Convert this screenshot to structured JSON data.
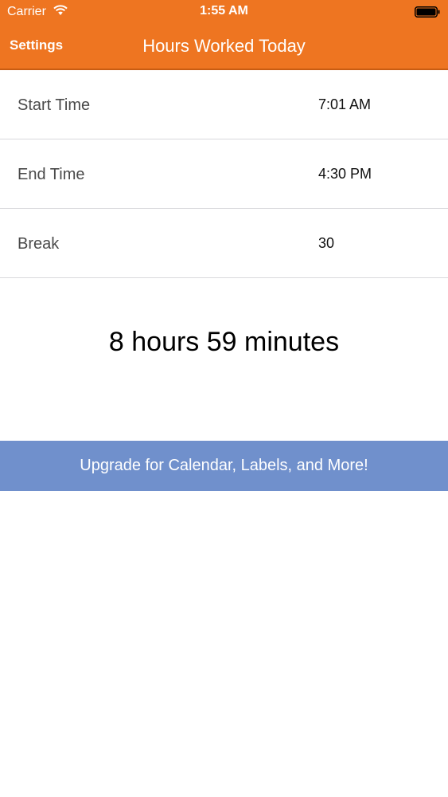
{
  "status_bar": {
    "carrier": "Carrier",
    "time": "1:55 AM"
  },
  "nav": {
    "back_label": "Settings",
    "title": "Hours Worked Today"
  },
  "rows": [
    {
      "label": "Start Time",
      "value": "7:01 AM"
    },
    {
      "label": "End Time",
      "value": "4:30 PM"
    },
    {
      "label": "Break",
      "value": "30"
    }
  ],
  "total": "8 hours 59 minutes",
  "upgrade_button": "Upgrade for Calendar, Labels, and More!",
  "colors": {
    "nav_background": "#ee7521",
    "upgrade_background": "#7090cc"
  },
  "icons": {
    "wifi": "wifi-icon",
    "battery": "battery-icon"
  }
}
